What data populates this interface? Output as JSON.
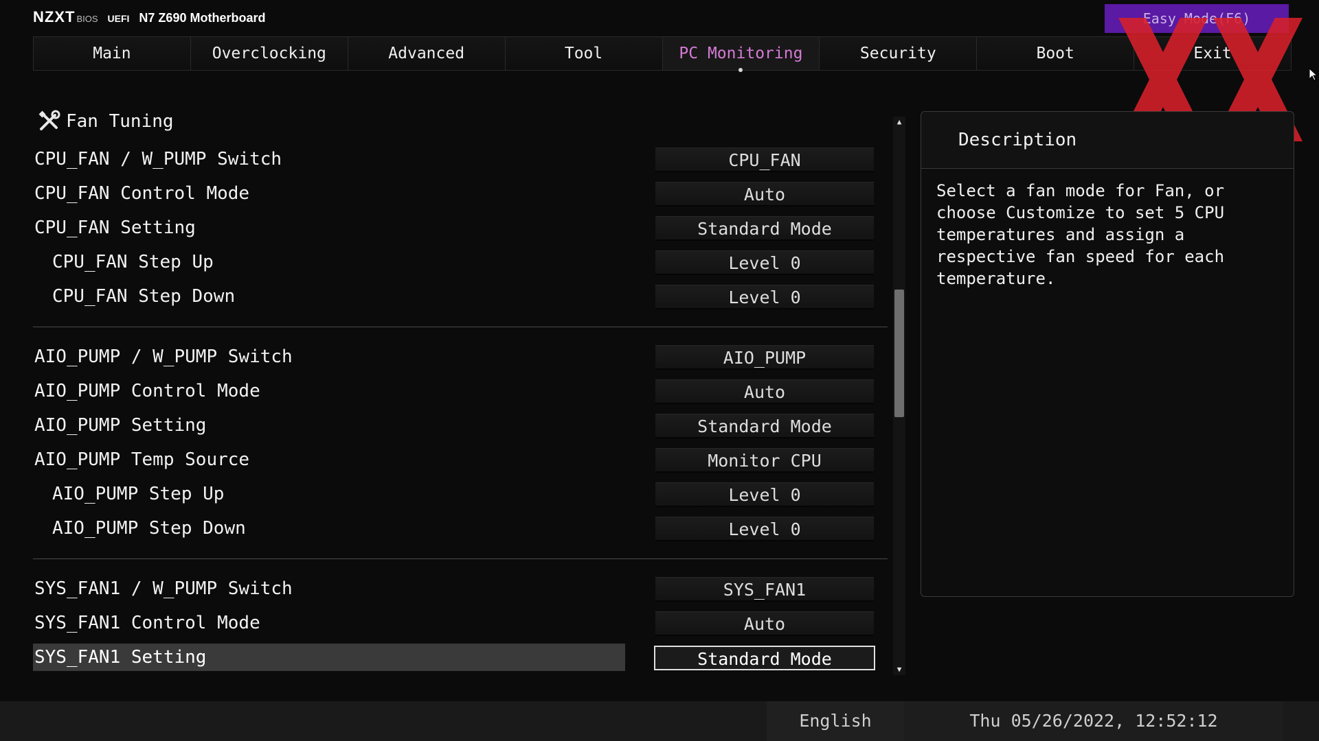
{
  "header": {
    "brand": "NZXT",
    "bios": "BIOS",
    "uefi": "UEFI",
    "model": "N7 Z690 Motherboard",
    "easy_mode_label": "Easy Mode(F6)"
  },
  "tabs": [
    {
      "label": "Main"
    },
    {
      "label": "Overclocking"
    },
    {
      "label": "Advanced"
    },
    {
      "label": "Tool"
    },
    {
      "label": "PC Monitoring"
    },
    {
      "label": "Security"
    },
    {
      "label": "Boot"
    },
    {
      "label": "Exit"
    }
  ],
  "active_tab": "PC Monitoring",
  "section": {
    "title": "Fan Tuning",
    "icon": "wrench-screwdriver-icon"
  },
  "rows": [
    {
      "label": "CPU_FAN / W_PUMP Switch",
      "value": "CPU_FAN"
    },
    {
      "label": "CPU_FAN Control Mode",
      "value": "Auto"
    },
    {
      "label": "CPU_FAN Setting",
      "value": "Standard Mode"
    },
    {
      "label": "CPU_FAN Step Up",
      "value": "Level 0"
    },
    {
      "label": "CPU_FAN Step Down",
      "value": "Level 0"
    },
    {
      "label": "AIO_PUMP / W_PUMP Switch",
      "value": "AIO_PUMP"
    },
    {
      "label": "AIO_PUMP Control Mode",
      "value": "Auto"
    },
    {
      "label": "AIO_PUMP Setting",
      "value": "Standard Mode"
    },
    {
      "label": "AIO_PUMP Temp Source",
      "value": "Monitor CPU"
    },
    {
      "label": "AIO_PUMP Step Up",
      "value": "Level 0"
    },
    {
      "label": "AIO_PUMP Step Down",
      "value": "Level 0"
    },
    {
      "label": "SYS_FAN1 / W_PUMP Switch",
      "value": "SYS_FAN1"
    },
    {
      "label": "SYS_FAN1 Control Mode",
      "value": "Auto"
    },
    {
      "label": "SYS_FAN1 Setting",
      "value": "Standard Mode"
    }
  ],
  "description": {
    "title": "Description",
    "text": "Select a fan mode for Fan, or choose Customize to set 5 CPU temperatures and assign a respective fan speed for each temperature."
  },
  "footer": {
    "language": "English",
    "datetime": "Thu 05/26/2022, 12:52:12"
  },
  "colors": {
    "accent_tab": "#d57ad6",
    "easy_mode_bg": "#5a1aa3",
    "watermark": "#d8202a"
  }
}
